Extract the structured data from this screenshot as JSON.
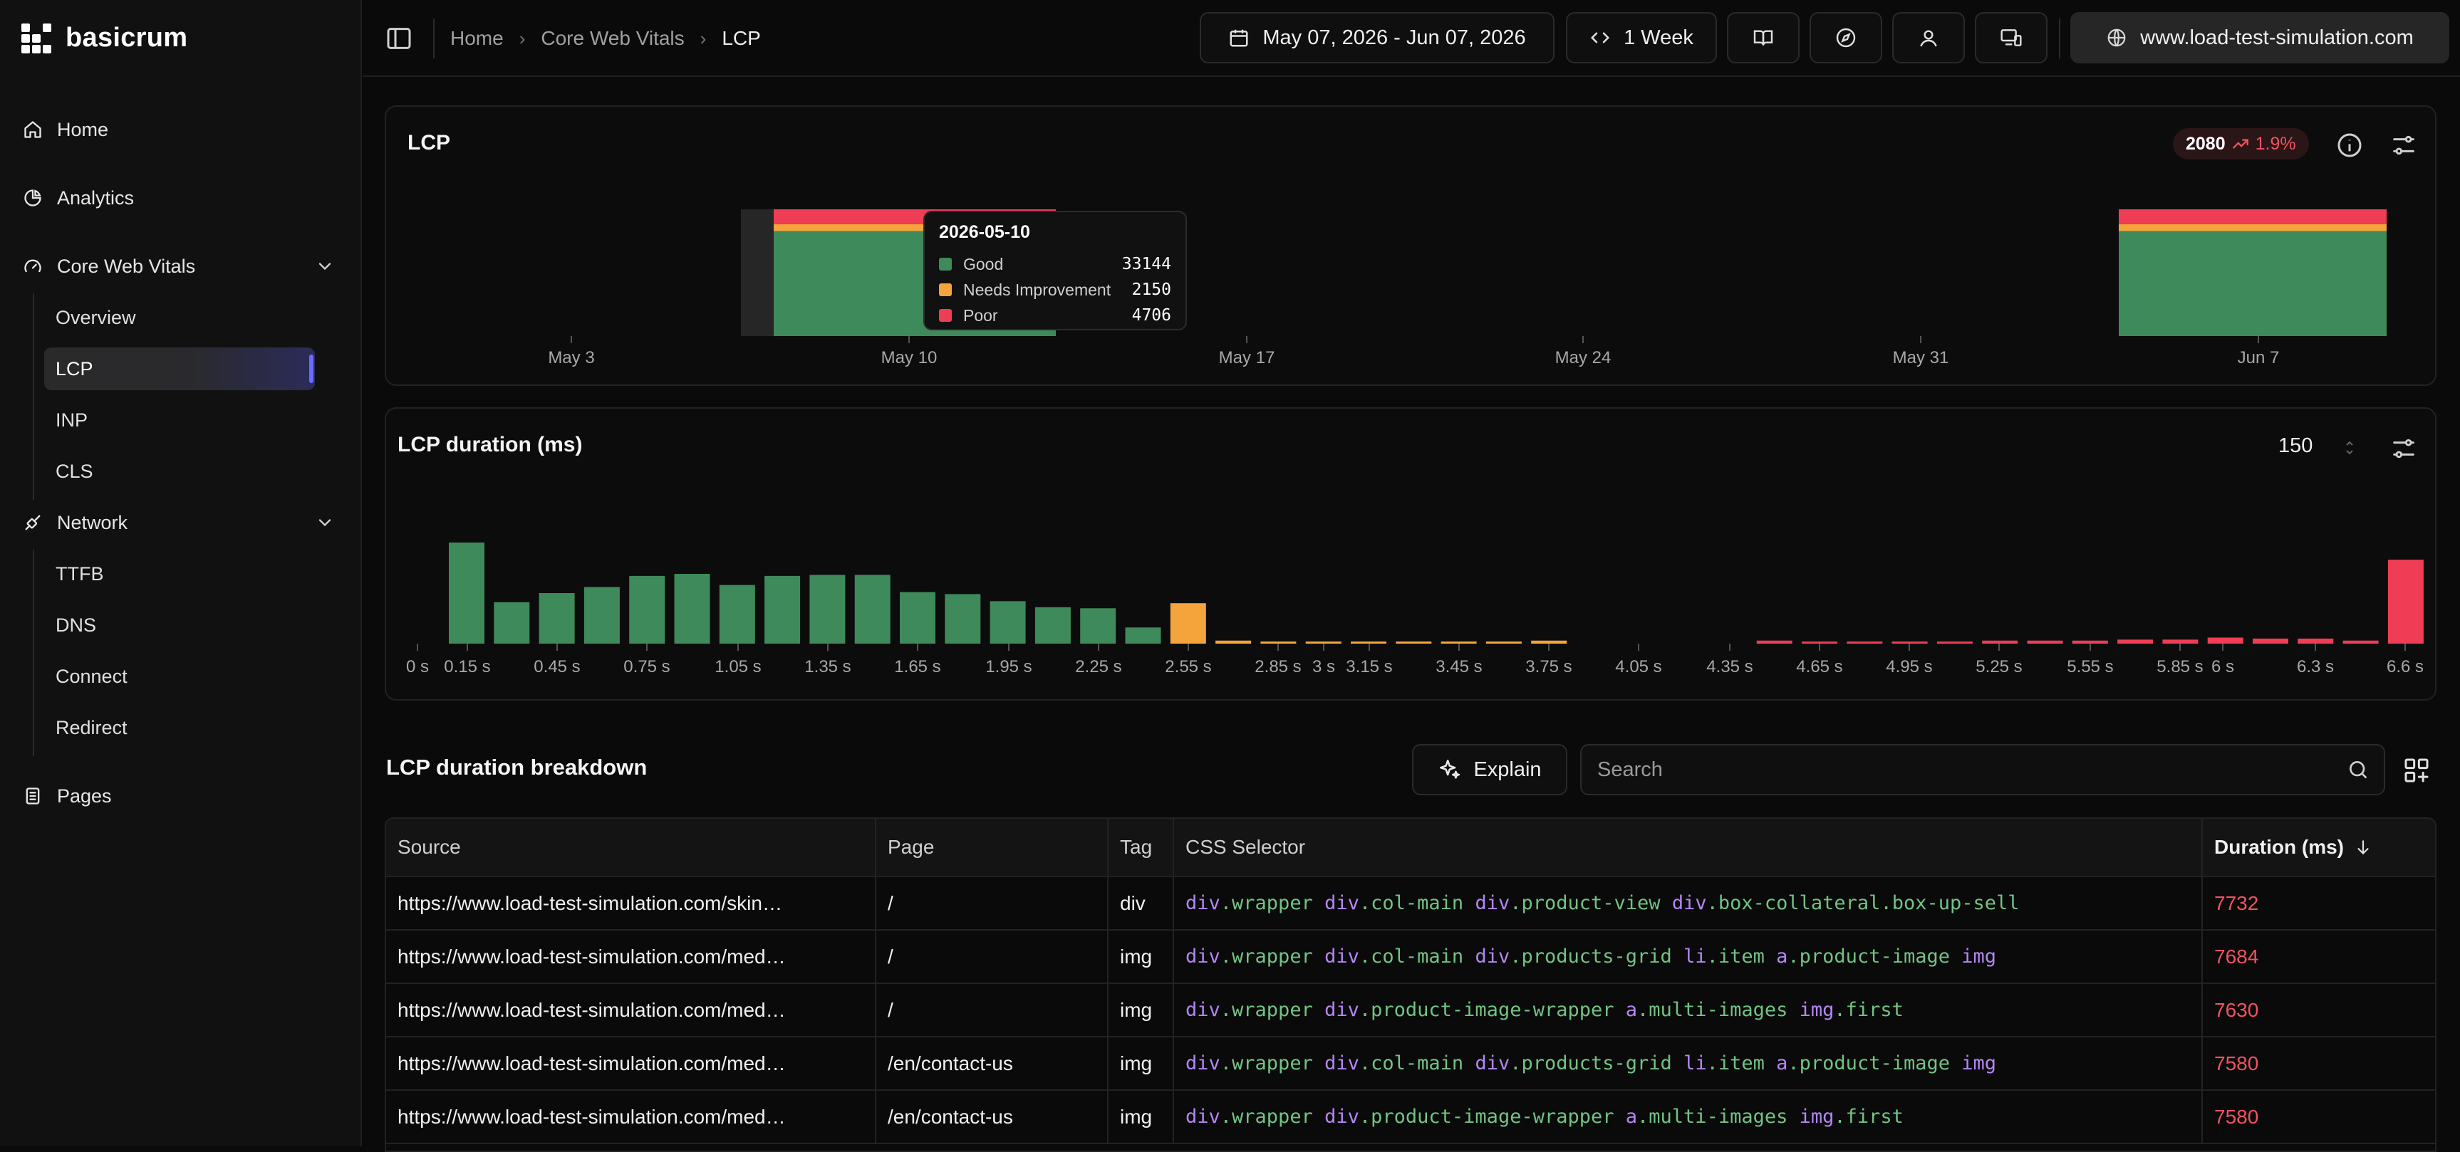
{
  "brand": {
    "name": "basicrum"
  },
  "sidebar": {
    "items": [
      {
        "label": "Home",
        "icon": "home-icon"
      },
      {
        "label": "Analytics",
        "icon": "pie-chart-icon"
      },
      {
        "label": "Core Web Vitals",
        "icon": "gauge-icon",
        "expanded": true,
        "children": [
          "Overview",
          "LCP",
          "INP",
          "CLS"
        ],
        "active": "LCP"
      },
      {
        "label": "Network",
        "icon": "cable-icon",
        "expanded": true,
        "children": [
          "TTFB",
          "DNS",
          "Connect",
          "Redirect"
        ]
      },
      {
        "label": "Pages",
        "icon": "document-icon"
      }
    ]
  },
  "header": {
    "breadcrumb": [
      "Home",
      "Core Web Vitals",
      "LCP"
    ],
    "date_range": "May 07, 2026 - Jun 07, 2026",
    "granularity": "1 Week",
    "site": "www.load-test-simulation.com"
  },
  "lcp_card": {
    "title": "LCP",
    "badge_value": "2080",
    "badge_change": "1.9%",
    "tooltip": {
      "date": "2026-05-10",
      "rows": [
        {
          "label": "Good",
          "value": "33144",
          "color": "#3e8a5a"
        },
        {
          "label": "Needs Improvement",
          "value": "2150",
          "color": "#f5a43b"
        },
        {
          "label": "Poor",
          "value": "4706",
          "color": "#ef3d56"
        }
      ]
    }
  },
  "histogram_card": {
    "title": "LCP duration (ms)",
    "bucket_size": "150"
  },
  "chart_data": [
    {
      "type": "bar",
      "stacked": true,
      "title": "LCP",
      "x_ticks": [
        "May 3",
        "May 10",
        "May 17",
        "May 24",
        "May 31",
        "Jun 7"
      ],
      "categories": [
        "2026-05-10",
        "2026-06-07"
      ],
      "series": [
        {
          "name": "Good",
          "color": "#3e8a5a",
          "values": [
            33144,
            33144
          ]
        },
        {
          "name": "Needs Improvement",
          "color": "#f5a43b",
          "values": [
            2150,
            2150
          ]
        },
        {
          "name": "Poor",
          "color": "#ef3d56",
          "values": [
            4706,
            4706
          ]
        }
      ]
    },
    {
      "type": "bar",
      "title": "LCP duration (ms)",
      "x_ticks": [
        "0 s",
        "0.15 s",
        "0.45 s",
        "0.75 s",
        "1.05 s",
        "1.35 s",
        "1.65 s",
        "1.95 s",
        "2.25 s",
        "2.55 s",
        "2.85 s",
        "3 s",
        "3.15 s",
        "3.45 s",
        "3.75 s",
        "4.05 s",
        "4.35 s",
        "4.65 s",
        "4.95 s",
        "5.25 s",
        "5.55 s",
        "5.85 s",
        "6 s",
        "6.3 s",
        "6.6 s"
      ],
      "x_ms": [
        150,
        300,
        450,
        600,
        750,
        900,
        1050,
        1200,
        1350,
        1500,
        1650,
        1800,
        1950,
        2100,
        2250,
        2400,
        2550,
        2700,
        2850,
        3000,
        3150,
        3300,
        3450,
        3600,
        3750,
        3900,
        4050,
        4200,
        4350,
        4500,
        4650,
        4800,
        4950,
        5100,
        5250,
        5400,
        5550,
        5700,
        5850,
        6000,
        6150,
        6300,
        6450,
        6600
      ],
      "values": [
        100,
        41,
        50,
        56,
        67,
        69,
        58,
        67,
        68,
        68,
        51,
        49,
        42,
        36,
        35,
        16,
        40,
        3,
        2,
        2,
        2,
        1,
        1,
        2,
        3,
        0,
        0,
        0,
        0,
        3,
        1,
        2,
        2,
        2,
        3,
        3,
        3,
        4,
        4,
        6,
        5,
        5,
        3,
        83
      ],
      "colors_by_rating": {
        "good": "#3e8a5a",
        "needs_improvement": "#f5a43b",
        "poor": "#ef3d56"
      }
    }
  ],
  "breakdown": {
    "title": "LCP duration breakdown",
    "explain_label": "Explain",
    "search_placeholder": "Search",
    "columns": [
      "Source",
      "Page",
      "Tag",
      "CSS Selector",
      "Duration (ms)"
    ],
    "rows": [
      {
        "source": "https://www.load-test-simulation.com/skin…",
        "page": "/",
        "tag": "div",
        "selector": [
          [
            "div",
            "wrapper"
          ],
          [
            "div",
            "col-main"
          ],
          [
            "div",
            "product-view"
          ],
          [
            "div",
            "box-collateral.box-up-sell"
          ]
        ],
        "duration": "7732"
      },
      {
        "source": "https://www.load-test-simulation.com/med…",
        "page": "/",
        "tag": "img",
        "selector": [
          [
            "div",
            "wrapper"
          ],
          [
            "div",
            "col-main"
          ],
          [
            "div",
            "products-grid"
          ],
          [
            "li",
            "item"
          ],
          [
            "a",
            "product-image"
          ],
          [
            "img",
            ""
          ]
        ],
        "duration": "7684"
      },
      {
        "source": "https://www.load-test-simulation.com/med…",
        "page": "/",
        "tag": "img",
        "selector": [
          [
            "div",
            "wrapper"
          ],
          [
            "div",
            "product-image-wrapper"
          ],
          [
            "a",
            "multi-images"
          ],
          [
            "img",
            "first"
          ]
        ],
        "duration": "7630"
      },
      {
        "source": "https://www.load-test-simulation.com/med…",
        "page": "/en/contact-us",
        "tag": "img",
        "selector": [
          [
            "div",
            "wrapper"
          ],
          [
            "div",
            "col-main"
          ],
          [
            "div",
            "products-grid"
          ],
          [
            "li",
            "item"
          ],
          [
            "a",
            "product-image"
          ],
          [
            "img",
            ""
          ]
        ],
        "duration": "7580"
      },
      {
        "source": "https://www.load-test-simulation.com/med…",
        "page": "/en/contact-us",
        "tag": "img",
        "selector": [
          [
            "div",
            "wrapper"
          ],
          [
            "div",
            "product-image-wrapper"
          ],
          [
            "a",
            "multi-images"
          ],
          [
            "img",
            "first"
          ]
        ],
        "duration": "7580"
      }
    ]
  }
}
